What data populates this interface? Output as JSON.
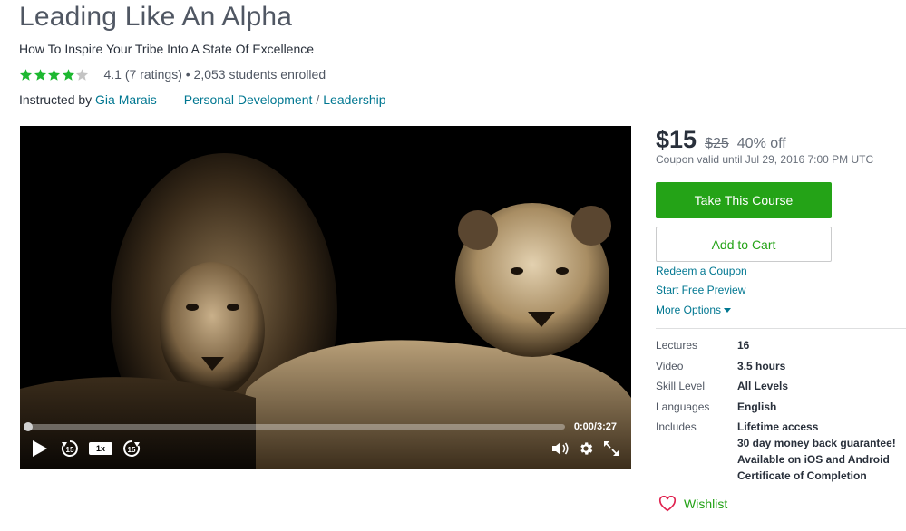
{
  "course": {
    "title": "Leading Like An Alpha",
    "subtitle": "How To Inspire Your Tribe Into A State Of Excellence",
    "rating_value": 4.1,
    "rating_text": "4.1 (7 ratings)",
    "students_text": " • 2,053 students enrolled",
    "instructed_by_label": "Instructed by ",
    "instructor": "Gia Marais",
    "category": "Personal Development",
    "category_sep": "/",
    "subcategory": "Leadership"
  },
  "video": {
    "time": "0:00/3:27",
    "progress": 0,
    "speed": "1x",
    "rewind_label": "15",
    "forward_label": "15"
  },
  "pricing": {
    "price": "$15",
    "original_price": "$25",
    "discount": "40% off",
    "coupon_valid": "Coupon valid until Jul 29, 2016 7:00 PM UTC"
  },
  "actions": {
    "take_course": "Take This Course",
    "add_to_cart": "Add to Cart",
    "redeem_coupon": "Redeem a Coupon",
    "free_preview": "Start Free Preview",
    "more_options": "More Options",
    "wishlist": "Wishlist"
  },
  "facts": [
    {
      "label": "Lectures",
      "value": "16"
    },
    {
      "label": "Video",
      "value": "3.5 hours"
    },
    {
      "label": "Skill Level",
      "value": "All Levels"
    },
    {
      "label": "Languages",
      "value": "English"
    }
  ],
  "includes": {
    "label": "Includes",
    "items": [
      "Lifetime access",
      "30 day money back guarantee!",
      "Available on iOS and Android",
      "Certificate of Completion"
    ]
  },
  "colors": {
    "star": "#1eb831",
    "star_empty": "#c4c4c4",
    "cta_green": "#24a317",
    "link": "#007791"
  }
}
